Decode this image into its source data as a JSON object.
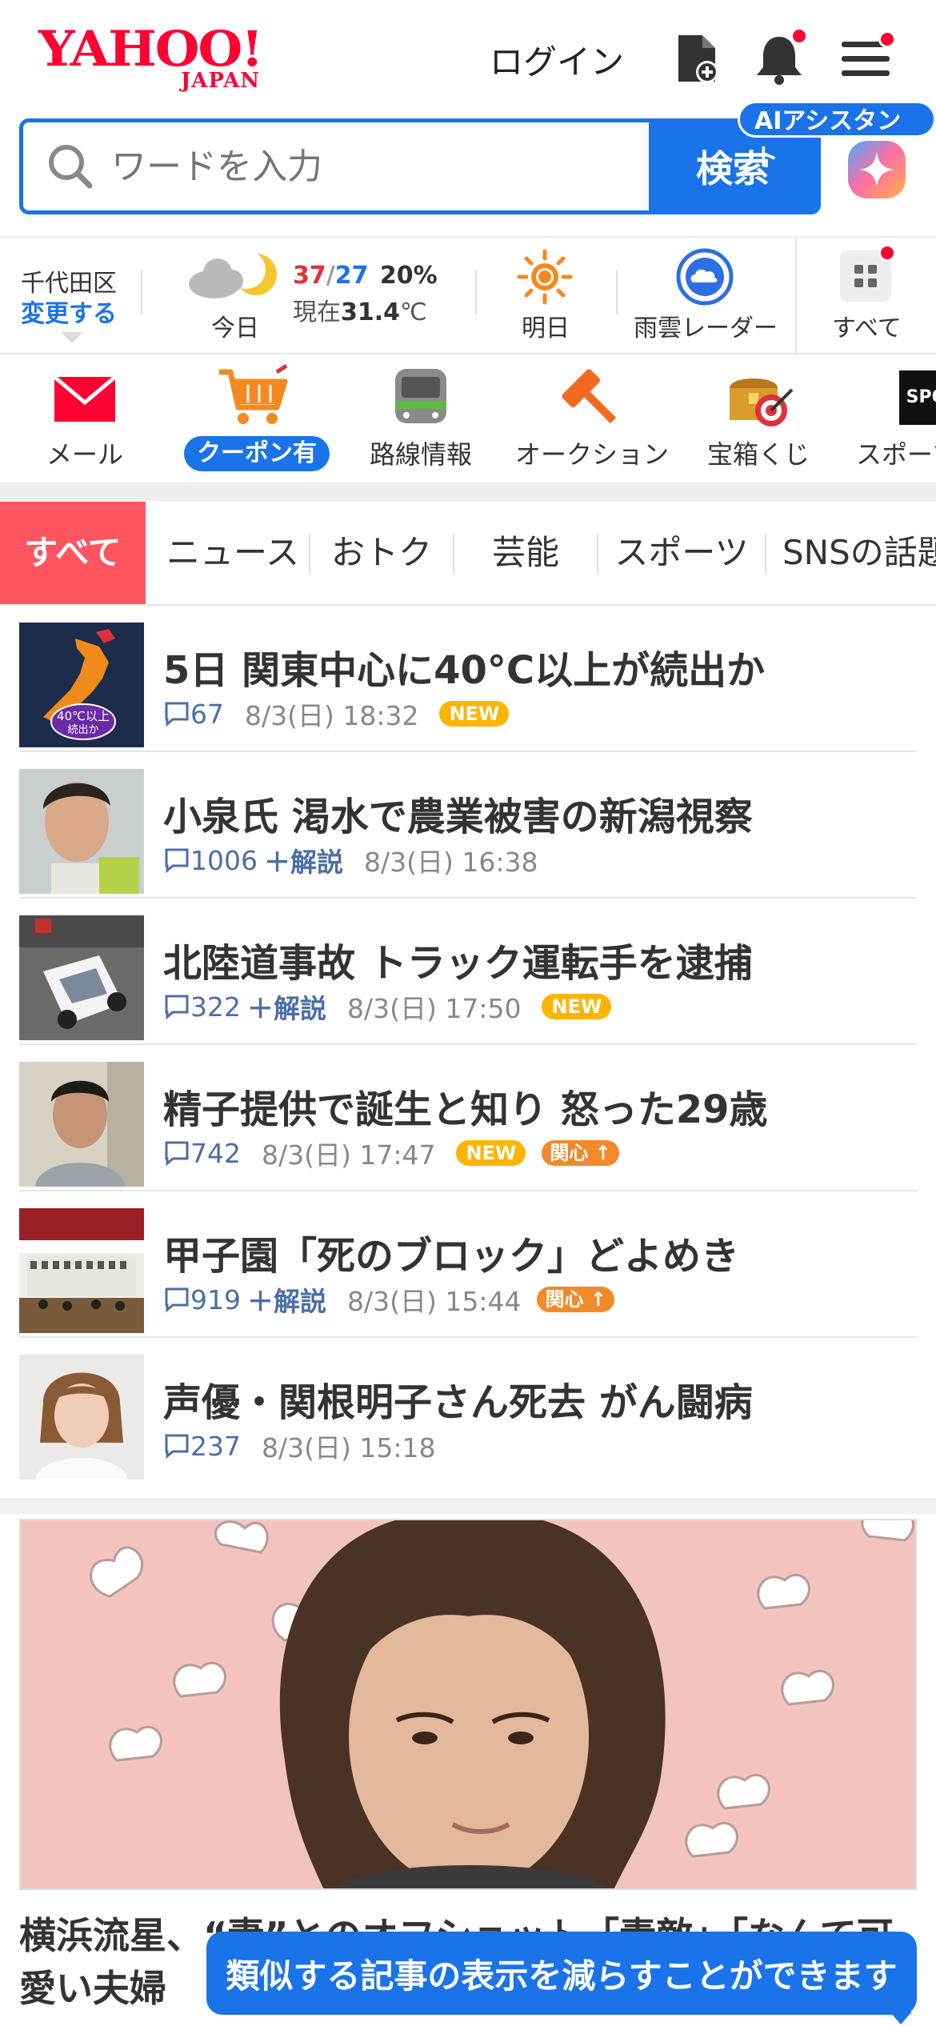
{
  "header": {
    "logo_main": "YAHOO!",
    "logo_sub": "JAPAN",
    "login": "ログイン",
    "search_placeholder": "ワードを入力",
    "search_button": "検索",
    "ai_badge": "AIアシスタント"
  },
  "weather": {
    "location": "千代田区",
    "change": "変更する",
    "today_label": "今日",
    "high": "37",
    "slash": "/",
    "low": "27",
    "rain": "20%",
    "current_prefix": "現在",
    "current_temp": "31.4",
    "current_unit": "℃",
    "tomorrow_label": "明日",
    "radar_label": "雨雲レーダー",
    "all_label": "すべて"
  },
  "services": {
    "mail": "メール",
    "coupon": "クーポン有",
    "transit": "路線情報",
    "auction": "オークション",
    "lottery": "宝箱くじ",
    "sports": "スポーツ"
  },
  "tabs": [
    "すべて",
    "ニュース",
    "おトク",
    "芸能",
    "スポーツ",
    "SNSの話題"
  ],
  "news": [
    {
      "title": "5日 関東中心に40°C以上が続出か",
      "comments": "67",
      "kaisetsu": "",
      "date": "8/3(日) 18:32",
      "new": "NEW",
      "kanshin": ""
    },
    {
      "title": "小泉氏 渇水で農業被害の新潟視察",
      "comments": "1006",
      "kaisetsu": "＋解説",
      "date": "8/3(日) 16:38",
      "new": "",
      "kanshin": ""
    },
    {
      "title": "北陸道事故 トラック運転手を逮捕",
      "comments": "322",
      "kaisetsu": "＋解説",
      "date": "8/3(日) 17:50",
      "new": "NEW",
      "kanshin": ""
    },
    {
      "title": "精子提供で誕生と知り 怒った29歳",
      "comments": "742",
      "kaisetsu": "",
      "date": "8/3(日) 17:47",
      "new": "NEW",
      "kanshin": "関心"
    },
    {
      "title": "甲子園「死のブロック」どよめき",
      "comments": "919",
      "kaisetsu": "＋解説",
      "date": "8/3(日) 15:44",
      "new": "",
      "kanshin": "関心"
    },
    {
      "title": "声優・関根明子さん死去 がん闘病",
      "comments": "237",
      "kaisetsu": "",
      "date": "8/3(日) 15:18",
      "new": "",
      "kanshin": ""
    }
  ],
  "thumb_map": {
    "label1": "40℃以上",
    "label2": "続出か"
  },
  "feature": {
    "title": "横浜流星、“妻”とのオフショット「素敵」「なんて可愛い夫婦"
  },
  "toast": "類似する記事の表示を減らすことができます",
  "colors": {
    "yahoo_red": "#ff0033",
    "blue": "#1a73e8",
    "tab_active": "#ff5560",
    "new_badge": "#ffb400"
  }
}
